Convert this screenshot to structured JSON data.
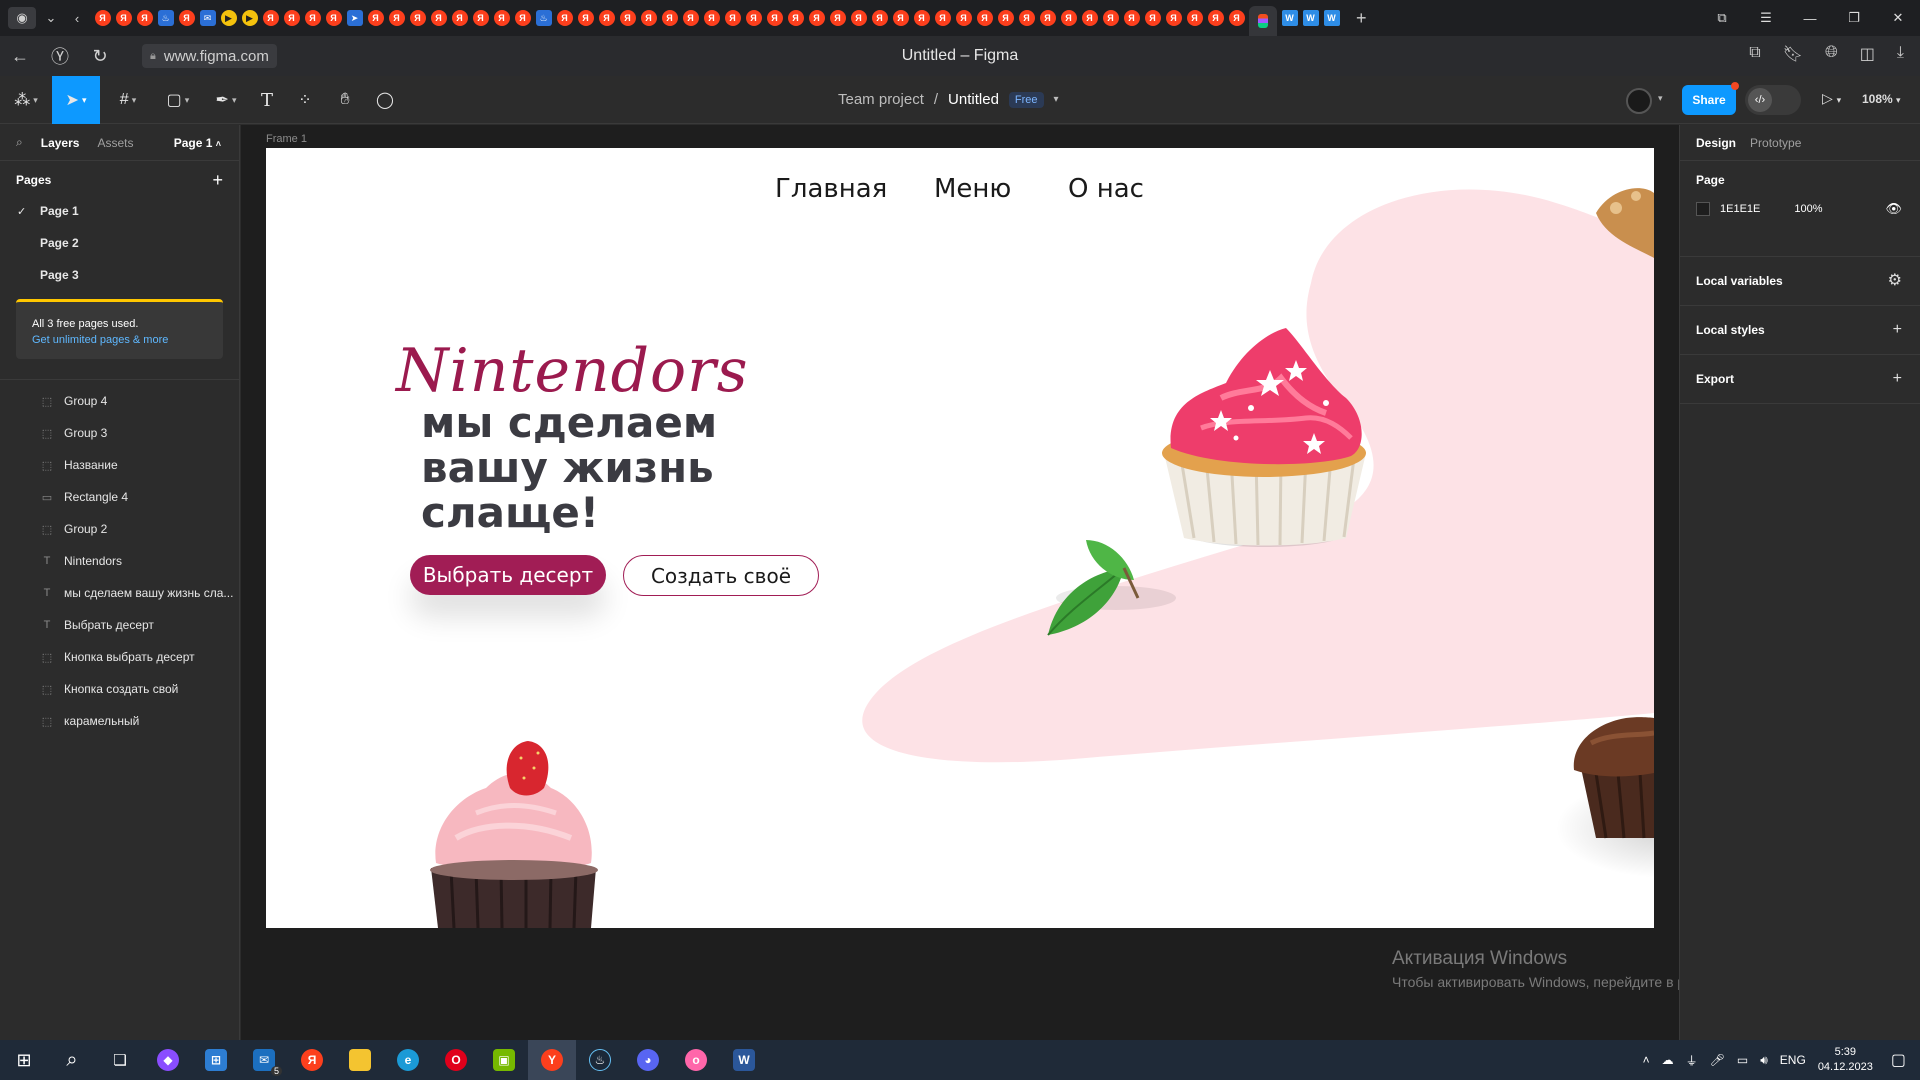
{
  "browser": {
    "url": "www.figma.com",
    "window_title": "Untitled – Figma",
    "tab_icons": [
      "yandex",
      "yandex",
      "yandex",
      "steam",
      "yandex",
      "mail",
      "youtube",
      "youtube",
      "yandex",
      "yandex",
      "yandex",
      "yandex",
      "telegram",
      "yandex",
      "yandex",
      "yandex",
      "yandex",
      "yandex",
      "yandex",
      "yandex",
      "yandex",
      "steam",
      "yandex",
      "yandex",
      "yandex",
      "yandex",
      "yandex",
      "yandex",
      "yandex",
      "yandex",
      "yandex",
      "yandex",
      "yandex",
      "yandex",
      "yandex",
      "yandex",
      "yandex",
      "yandex",
      "yandex",
      "yandex",
      "yandex",
      "yandex",
      "yandex",
      "yandex",
      "yandex",
      "yandex",
      "yandex",
      "yandex",
      "yandex",
      "yandex",
      "yandex",
      "yandex",
      "yandex",
      "yandex",
      "yandex"
    ]
  },
  "toolbar": {
    "team": "Team project",
    "separator": "/",
    "file_name": "Untitled",
    "plan_badge": "Free",
    "share_label": "Share",
    "zoom": "108%"
  },
  "left_panel": {
    "tabs": {
      "layers": "Layers",
      "assets": "Assets",
      "page_selector": "Page 1"
    },
    "pages_title": "Pages",
    "pages": [
      {
        "label": "Page 1",
        "selected": true
      },
      {
        "label": "Page 2",
        "selected": false
      },
      {
        "label": "Page 3",
        "selected": false
      }
    ],
    "upsell": {
      "text": "All 3 free pages used.",
      "link": "Get unlimited pages & more"
    },
    "layers": [
      {
        "name": "Frame 1",
        "kind": "frame"
      },
      {
        "name": "Group 4",
        "kind": "group"
      },
      {
        "name": "Group 3",
        "kind": "group"
      },
      {
        "name": "Название",
        "kind": "group"
      },
      {
        "name": "Rectangle 4",
        "kind": "rect"
      },
      {
        "name": "Group 2",
        "kind": "group"
      },
      {
        "name": "Nintendors",
        "kind": "text"
      },
      {
        "name": "мы сделаем вашу жизнь сла...",
        "kind": "text"
      },
      {
        "name": "Выбрать десерт",
        "kind": "text"
      },
      {
        "name": "Кнопка выбрать десерт",
        "kind": "group"
      },
      {
        "name": "Кнопка создать свой",
        "kind": "group"
      },
      {
        "name": "карамельный",
        "kind": "group"
      }
    ]
  },
  "canvas": {
    "frame_label": "Frame 1",
    "design": {
      "nav": [
        "Главная",
        "Меню",
        "О нас"
      ],
      "brand": "Nintendors",
      "tagline": "мы сделаем вашу жизнь слаще!",
      "primary_button": "Выбрать десерт",
      "secondary_button": "Создать своё",
      "colors": {
        "brand": "#9b1a4e",
        "button": "#a11d55",
        "blob": "#fde2e6",
        "text": "#3b3b42"
      }
    },
    "watermark": {
      "title": "Активация Windows",
      "subtitle": "Чтобы активировать Windows, перейдите в раздел \"Параметры\"."
    },
    "help": "?"
  },
  "right_panel": {
    "tabs": {
      "design": "Design",
      "prototype": "Prototype"
    },
    "page_section": "Page",
    "page_color": "1E1E1E",
    "page_opacity": "100%",
    "sections": [
      "Local variables",
      "Local styles",
      "Export"
    ]
  },
  "taskbar": {
    "lang": "ENG",
    "time": "5:39",
    "date": "04.12.2023",
    "mail_badge": "5"
  }
}
